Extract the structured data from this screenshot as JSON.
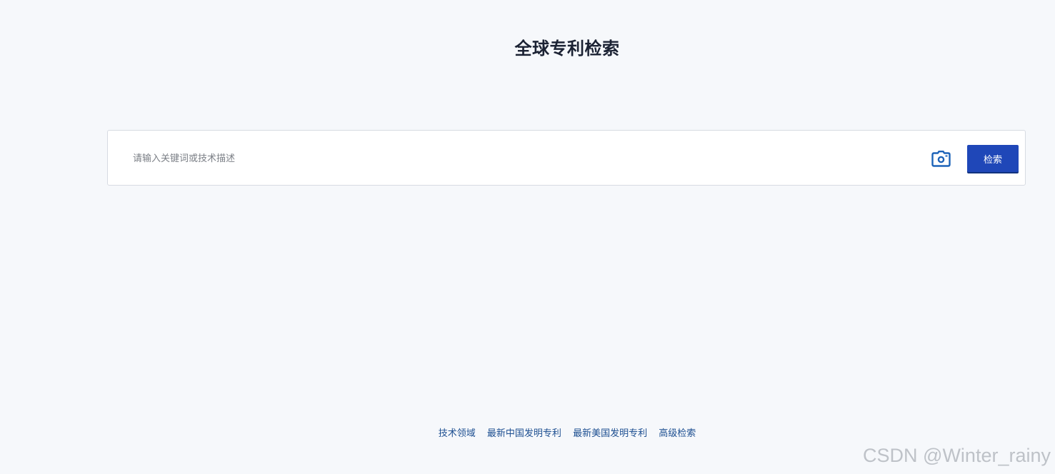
{
  "header": {
    "title": "全球专利检索"
  },
  "search": {
    "placeholder": "请输入关键词或技术描述",
    "value": "",
    "camera_icon": "camera-icon",
    "button_label": "检索"
  },
  "footer": {
    "links": [
      {
        "label": "技术领域"
      },
      {
        "label": "最新中国发明专利"
      },
      {
        "label": "最新美国发明专利"
      },
      {
        "label": "高级检索"
      }
    ]
  },
  "watermark": {
    "text": "CSDN @Winter_rainy"
  },
  "colors": {
    "background": "#f6f8fb",
    "accent": "#1f47b8",
    "link": "#1d4f91",
    "icon": "#1d63b8"
  }
}
